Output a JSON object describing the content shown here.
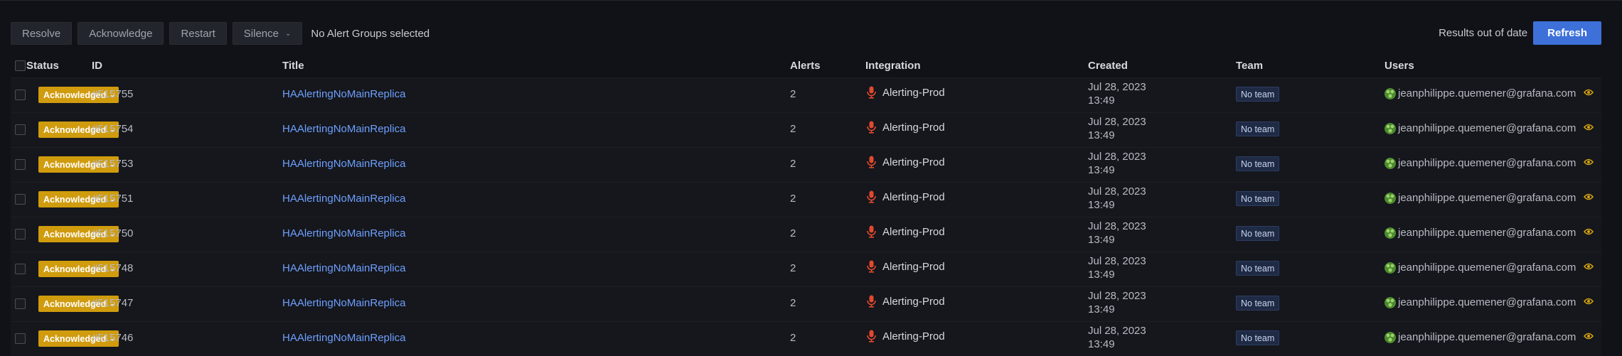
{
  "toolbar": {
    "resolve": "Resolve",
    "acknowledge": "Acknowledge",
    "restart": "Restart",
    "silence": "Silence",
    "selection": "No Alert Groups selected"
  },
  "rightbar": {
    "outdated": "Results out of date",
    "refresh": "Refresh"
  },
  "headers": {
    "status": "Status",
    "id": "ID",
    "title": "Title",
    "alerts": "Alerts",
    "integration": "Integration",
    "created": "Created",
    "team": "Team",
    "users": "Users"
  },
  "colors": {
    "acknowledged": "#d09c0e",
    "link": "#6e9fff",
    "refresh": "#3d71d9",
    "integration_icon": "#e2492f"
  },
  "icons": {
    "integration": "microphone-icon",
    "user": "avatar-icon",
    "watch": "eye-icon",
    "dropdown": "chevron-down-icon"
  },
  "rows": [
    {
      "status": "Acknowledged",
      "id": "#515755",
      "title": "HAAlertingNoMainReplica",
      "alerts": "2",
      "integration": "Alerting-Prod",
      "created_date": "Jul 28, 2023",
      "created_time": "13:49",
      "team": "No team",
      "user": "jeanphilippe.quemener@grafana.com"
    },
    {
      "status": "Acknowledged",
      "id": "#515754",
      "title": "HAAlertingNoMainReplica",
      "alerts": "2",
      "integration": "Alerting-Prod",
      "created_date": "Jul 28, 2023",
      "created_time": "13:49",
      "team": "No team",
      "user": "jeanphilippe.quemener@grafana.com"
    },
    {
      "status": "Acknowledged",
      "id": "#515753",
      "title": "HAAlertingNoMainReplica",
      "alerts": "2",
      "integration": "Alerting-Prod",
      "created_date": "Jul 28, 2023",
      "created_time": "13:49",
      "team": "No team",
      "user": "jeanphilippe.quemener@grafana.com"
    },
    {
      "status": "Acknowledged",
      "id": "#515751",
      "title": "HAAlertingNoMainReplica",
      "alerts": "2",
      "integration": "Alerting-Prod",
      "created_date": "Jul 28, 2023",
      "created_time": "13:49",
      "team": "No team",
      "user": "jeanphilippe.quemener@grafana.com"
    },
    {
      "status": "Acknowledged",
      "id": "#515750",
      "title": "HAAlertingNoMainReplica",
      "alerts": "2",
      "integration": "Alerting-Prod",
      "created_date": "Jul 28, 2023",
      "created_time": "13:49",
      "team": "No team",
      "user": "jeanphilippe.quemener@grafana.com"
    },
    {
      "status": "Acknowledged",
      "id": "#515748",
      "title": "HAAlertingNoMainReplica",
      "alerts": "2",
      "integration": "Alerting-Prod",
      "created_date": "Jul 28, 2023",
      "created_time": "13:49",
      "team": "No team",
      "user": "jeanphilippe.quemener@grafana.com"
    },
    {
      "status": "Acknowledged",
      "id": "#515747",
      "title": "HAAlertingNoMainReplica",
      "alerts": "2",
      "integration": "Alerting-Prod",
      "created_date": "Jul 28, 2023",
      "created_time": "13:49",
      "team": "No team",
      "user": "jeanphilippe.quemener@grafana.com"
    },
    {
      "status": "Acknowledged",
      "id": "#515746",
      "title": "HAAlertingNoMainReplica",
      "alerts": "2",
      "integration": "Alerting-Prod",
      "created_date": "Jul 28, 2023",
      "created_time": "13:49",
      "team": "No team",
      "user": "jeanphilippe.quemener@grafana.com"
    }
  ]
}
